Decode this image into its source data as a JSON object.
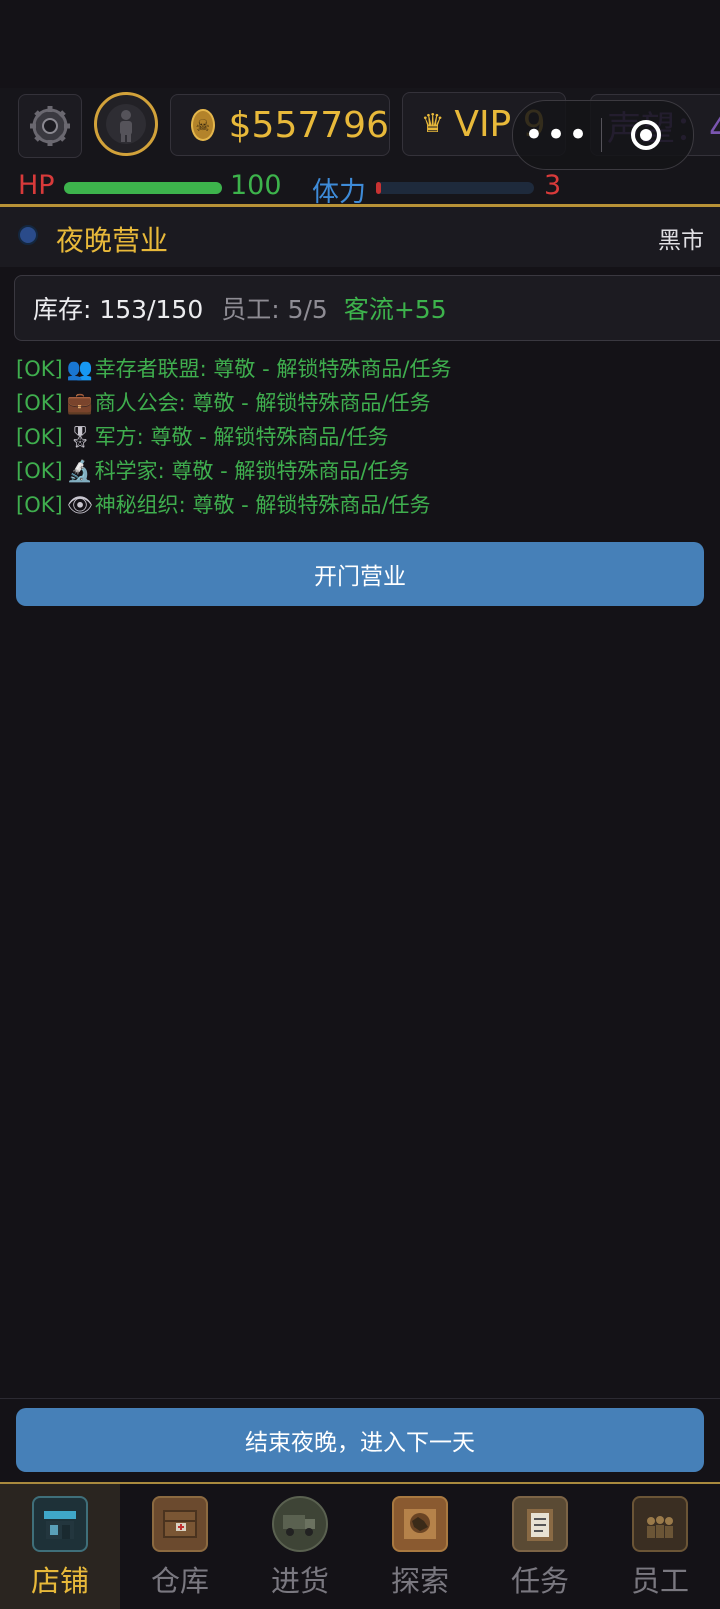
{
  "header": {
    "money": "$557796",
    "vip": "VIP 9",
    "reputation": "声望：4"
  },
  "capsule": {
    "menu_glyph": "•••"
  },
  "stats": {
    "hp_label": "HP",
    "hp_value": "100",
    "hp_fraction": 1.0,
    "stamina_label": "体力",
    "stamina_value": "3",
    "stamina_fraction": 0.03
  },
  "section": {
    "title": "夜晚营业",
    "right_label": "黑市"
  },
  "inventory": {
    "stock": "库存: 153/150",
    "staff": "员工: 5/5",
    "traffic": "客流+55"
  },
  "factions": [
    {
      "status": "[OK]",
      "icon": "👥",
      "text": "幸存者联盟: 尊敬 - 解锁特殊商品/任务"
    },
    {
      "status": "[OK]",
      "icon": "💼",
      "text": "商人公会: 尊敬 - 解锁特殊商品/任务"
    },
    {
      "status": "[OK]",
      "icon": "🎖",
      "text": "军方: 尊敬 - 解锁特殊商品/任务"
    },
    {
      "status": "[OK]",
      "icon": "🔬",
      "text": "科学家: 尊敬 - 解锁特殊商品/任务"
    },
    {
      "status": "[OK]",
      "icon": "👁",
      "text": "神秘组织: 尊敬 - 解锁特殊商品/任务"
    }
  ],
  "buttons": {
    "open": "开门营业",
    "end_night": "结束夜晚，进入下一天"
  },
  "tabs": [
    {
      "label": "店铺",
      "icon": "shop-icon",
      "active": true
    },
    {
      "label": "仓库",
      "icon": "warehouse-icon",
      "active": false
    },
    {
      "label": "进货",
      "icon": "truck-icon",
      "active": false
    },
    {
      "label": "探索",
      "icon": "map-icon",
      "active": false
    },
    {
      "label": "任务",
      "icon": "clipboard-icon",
      "active": false
    },
    {
      "label": "员工",
      "icon": "staff-icon",
      "active": false
    }
  ],
  "colors": {
    "accent_gold": "#e8b93a",
    "button_blue": "#4680b8",
    "ok_green": "#3fae4e",
    "hp_red": "#d83a3a",
    "stamina_blue": "#3e8bd8"
  }
}
